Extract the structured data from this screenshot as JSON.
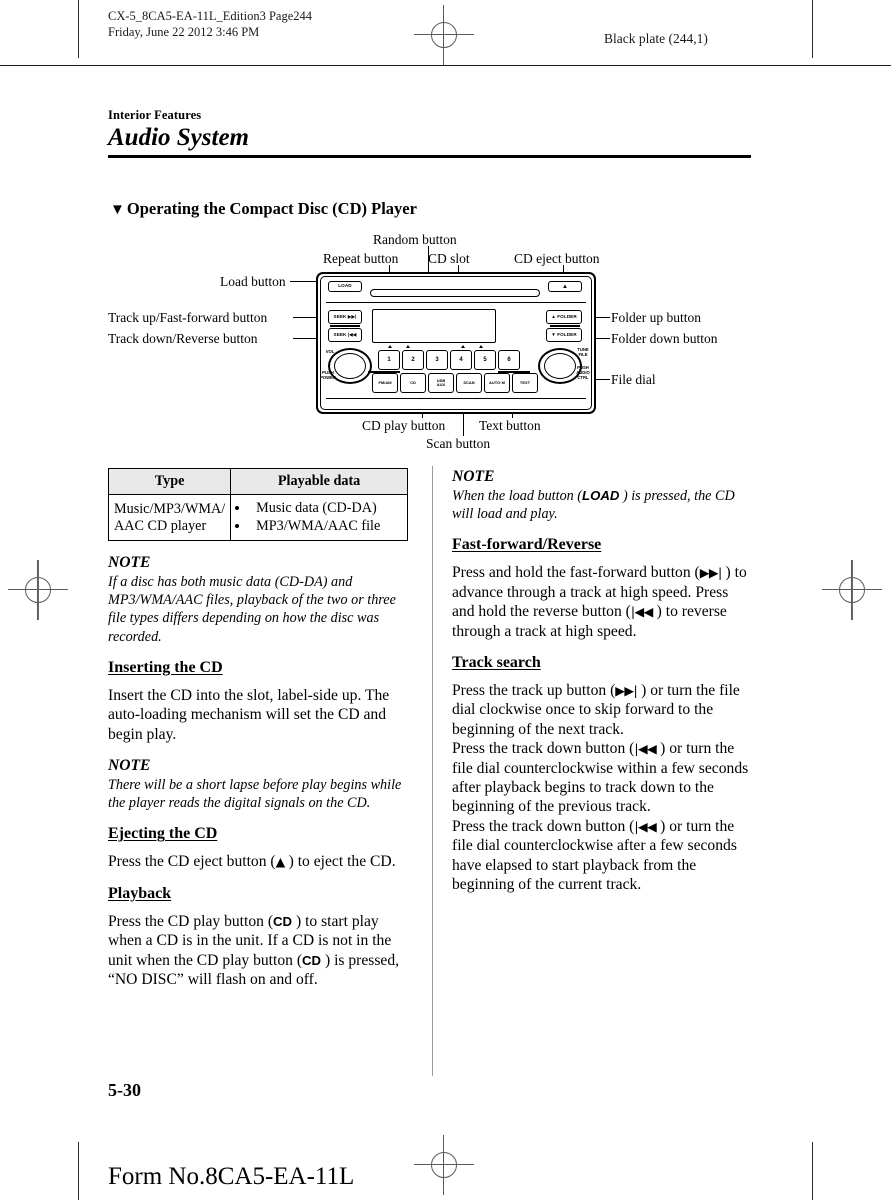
{
  "print_marks": {
    "running_head": "CX-5_8CA5-EA-11L_Edition3 Page244\nFriday, June 22 2012 3:46 PM",
    "plate_label": "Black plate (244,1)"
  },
  "chapter": {
    "kicker": "Interior Features",
    "title": "Audio System"
  },
  "section": {
    "bullet": "▼",
    "title": "Operating the Compact Disc (CD) Player"
  },
  "diagram": {
    "callouts": {
      "random_button": "Random button",
      "repeat_button": "Repeat button",
      "cd_slot": "CD slot",
      "cd_eject_button": "CD eject button",
      "load_button": "Load button",
      "track_up_ff_button": "Track up/Fast-forward button",
      "track_down_rev_button": "Track down/Reverse button",
      "folder_up_button": "Folder up button",
      "folder_down_button": "Folder down button",
      "file_dial": "File dial",
      "cd_play_button": "CD play button",
      "text_button": "Text button",
      "scan_button": "Scan button"
    },
    "faceplate": {
      "load": "LOAD",
      "eject": "▲",
      "seek_up": "SEEK ▶▶|",
      "seek_down": "SEEK |◀◀",
      "folder_up": "▲ FOLDER",
      "folder_down": "▼ FOLDER",
      "vol": "VOL",
      "push_power": "PUSH\nPOWER",
      "tune_file": "TUNE\nFILE",
      "push_audio_ctrl": "PUSH\nAUDIO\nCTRL",
      "presets": [
        "1",
        "2",
        "3",
        "4",
        "5",
        "6"
      ],
      "function_buttons": [
        "FM/AM",
        "CD",
        "USB\nAUX",
        "SCAN",
        "AUTO·M",
        "TEXT"
      ]
    }
  },
  "table": {
    "headers": [
      "Type",
      "Playable data"
    ],
    "rows": [
      {
        "type": "Music/MP3/WMA/ AAC CD player",
        "playable": [
          "Music data (CD-DA)",
          "MP3/WMA/AAC file"
        ]
      }
    ]
  },
  "left_column": {
    "note1_label": "NOTE",
    "note1_text": "If a disc has both music data (CD-DA) and MP3/WMA/AAC files, playback of the two or three file types differs depending on how the disc was recorded.",
    "inserting_heading": "Inserting the CD",
    "inserting_text": "Insert the CD into the slot, label-side up. The auto-loading mechanism will set the CD and begin play.",
    "note2_label": "NOTE",
    "note2_text": "There will be a short lapse before play begins while the player reads the digital signals on the CD.",
    "ejecting_heading": "Ejecting the CD",
    "ejecting_text_a": "Press the CD eject button (",
    "ejecting_glyph": "▲",
    "ejecting_text_b": " ) to eject the CD.",
    "playback_heading": "Playback",
    "playback_a": "Press the CD play button (",
    "playback_cd1": "CD",
    "playback_b": " ) to start play when a CD is in the unit. If a CD is not in the unit when the CD play button (",
    "playback_cd2": "CD",
    "playback_c": " ) is pressed, “NO DISC” will flash on and off."
  },
  "right_column": {
    "note_label": "NOTE",
    "note_a": "When the load button (",
    "note_load": "LOAD",
    "note_b": " ) is pressed, the CD will load and play.",
    "ff_heading": "Fast-forward/Reverse",
    "ff_a": "Press and hold the fast-forward button (",
    "ff_glyph": "▶▶|",
    "ff_b": " ) to advance through a track at high speed. Press and hold the reverse button (",
    "rev_glyph": "|◀◀",
    "ff_c": " ) to reverse through a track at high speed.",
    "search_heading": "Track search",
    "search_p1_a": "Press the track up button (",
    "search_p1_glyph": "▶▶|",
    "search_p1_b": " ) or turn the file dial clockwise once to skip forward to the beginning of the next track.",
    "search_p2_a": "Press the track down button (",
    "search_p2_glyph": "|◀◀",
    "search_p2_b": " ) or turn the file dial counterclockwise within a few seconds after playback begins to track down to the beginning of the previous track.",
    "search_p3_a": "Press the track down button (",
    "search_p3_glyph": "|◀◀",
    "search_p3_b": " ) or turn the file dial counterclockwise after a few seconds have elapsed to start playback from the beginning of the current track."
  },
  "footer": {
    "page_number": "5-30",
    "form_number": "Form No.8CA5-EA-11L"
  }
}
